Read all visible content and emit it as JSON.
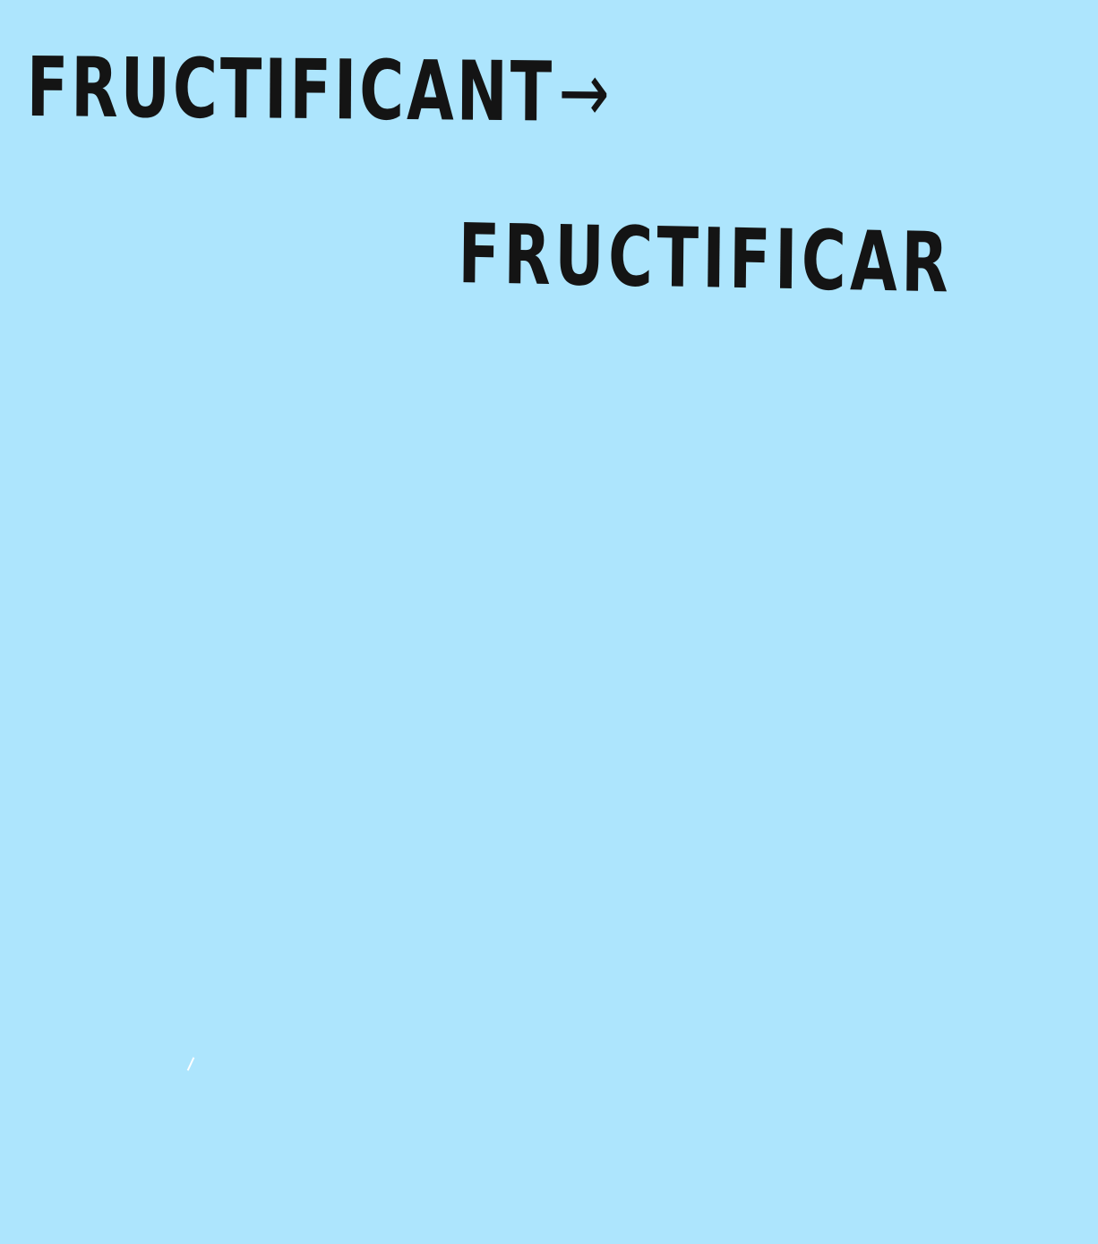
{
  "note": {
    "background_color": "#ade5fd",
    "ink_color": "#141414",
    "line_1": {
      "word": "FRUCTIFICANT",
      "arrow": "→"
    },
    "line_2": {
      "word": "FRUCTIFICAR"
    }
  }
}
